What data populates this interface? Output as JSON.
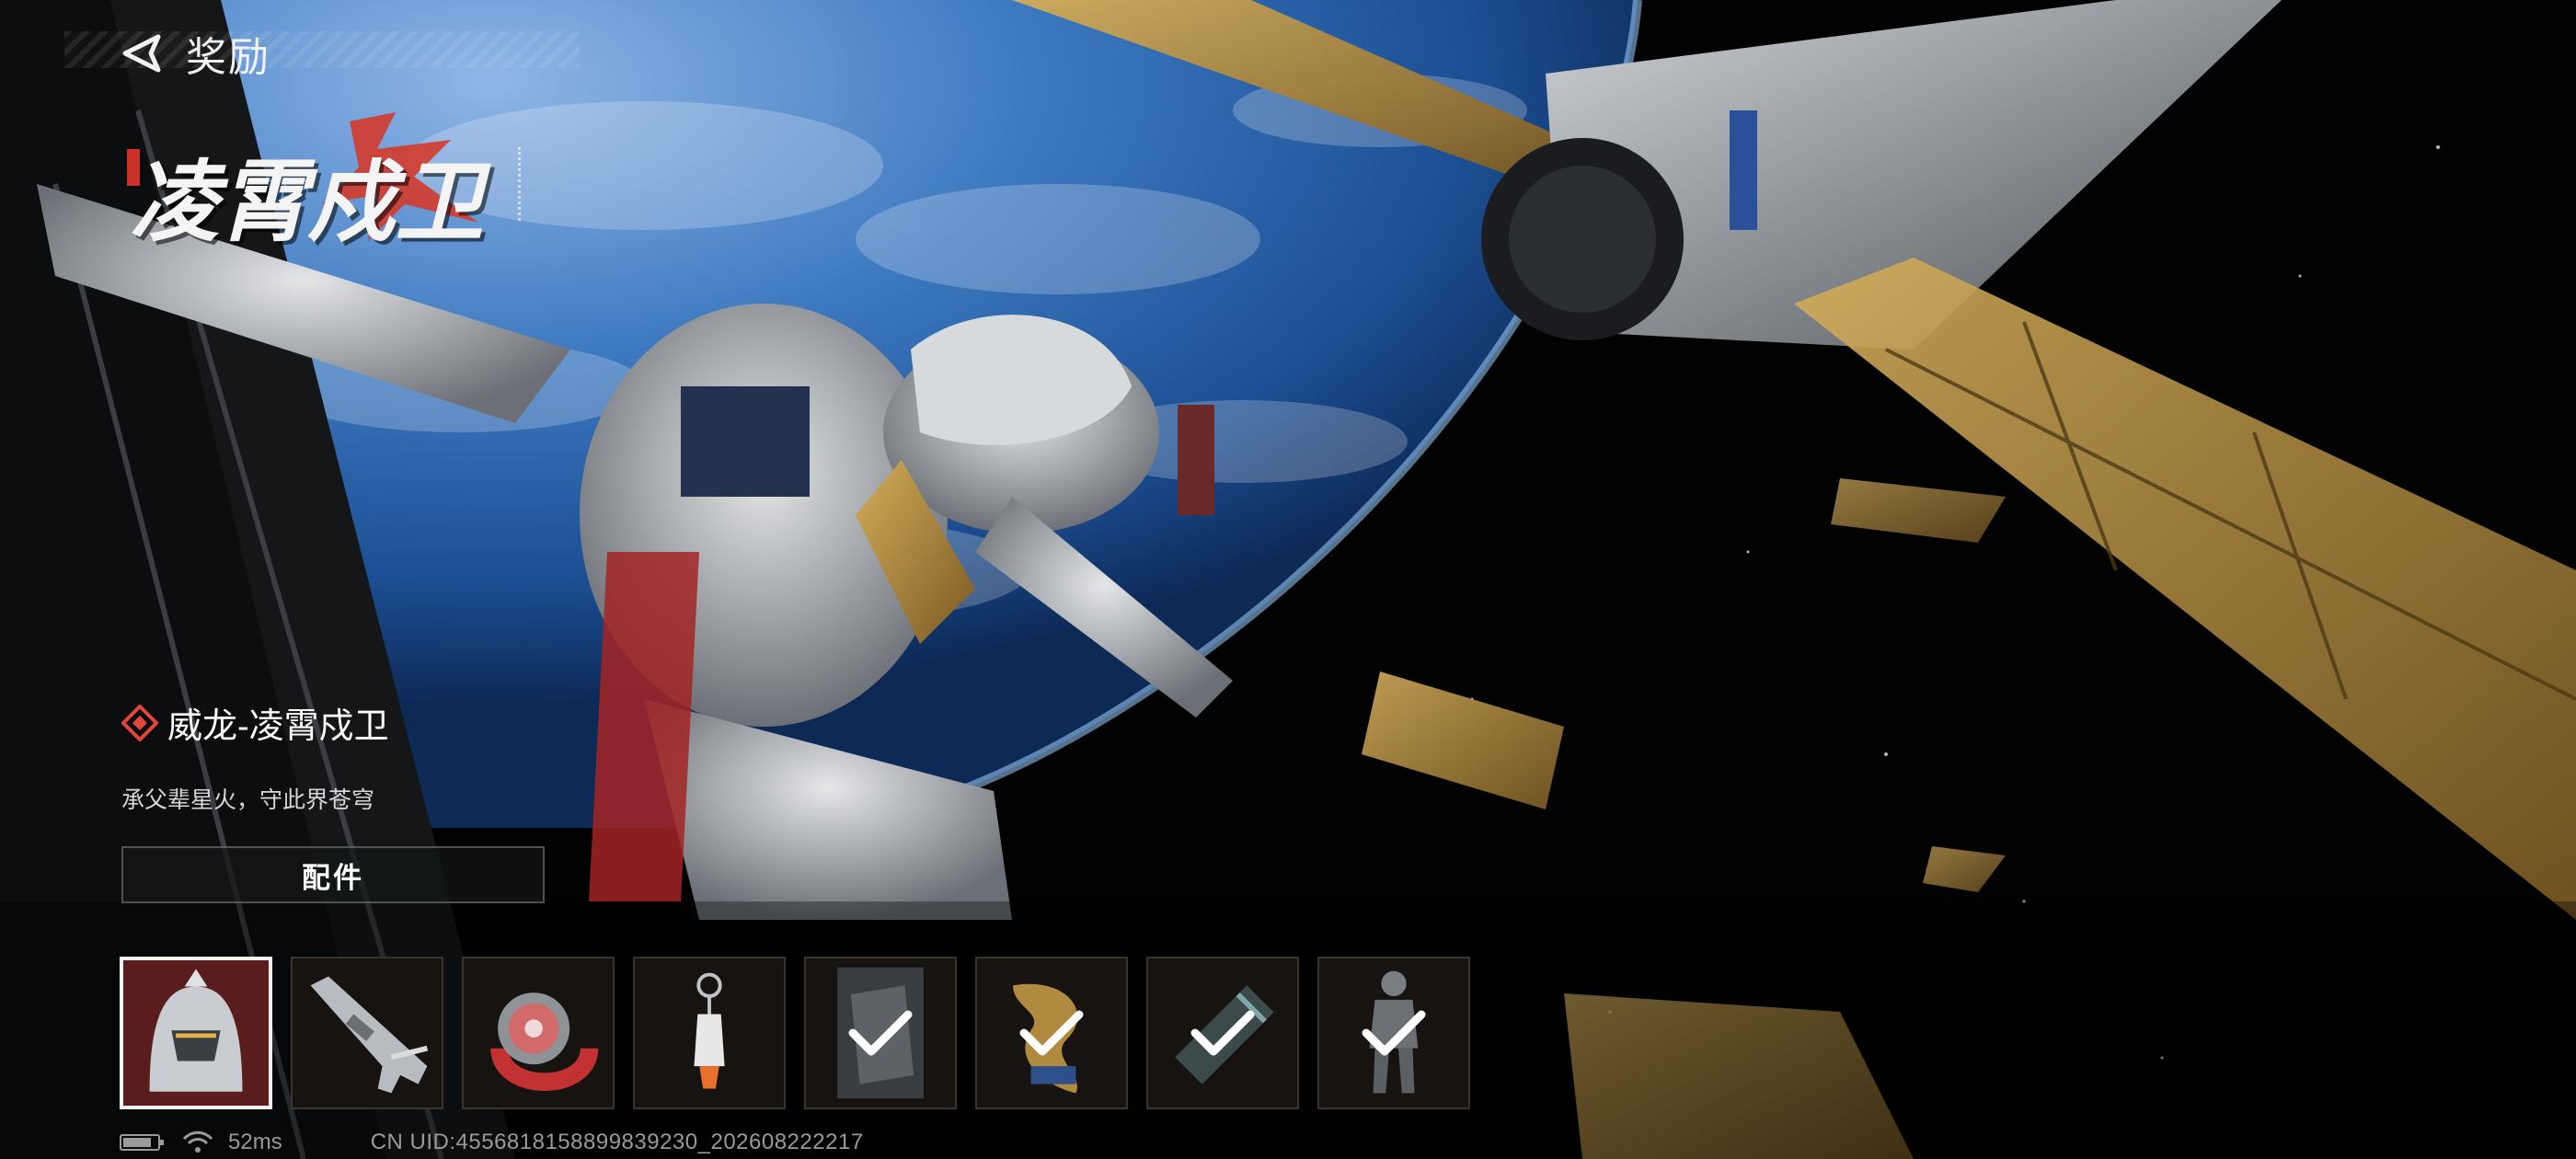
{
  "header": {
    "title": "奖励"
  },
  "logo": {
    "text": "凌霄戍卫"
  },
  "skin": {
    "name": "威龙-凌霄戍卫",
    "description": "承父辈星火，守此界苍穹",
    "rarity_color": "#e0473c"
  },
  "parts_button": {
    "label": "配件"
  },
  "items": [
    {
      "name": "helmet",
      "claimed": false,
      "selected": true
    },
    {
      "name": "rifle",
      "claimed": false,
      "selected": false
    },
    {
      "name": "watch",
      "claimed": false,
      "selected": false
    },
    {
      "name": "keychain",
      "claimed": false,
      "selected": false
    },
    {
      "name": "calling-card",
      "claimed": true,
      "selected": false
    },
    {
      "name": "dragon-emblem",
      "claimed": true,
      "selected": false
    },
    {
      "name": "magazine",
      "claimed": true,
      "selected": false
    },
    {
      "name": "operator-pose",
      "claimed": true,
      "selected": false
    }
  ],
  "status": {
    "battery_level": 0.85,
    "ping": "52ms",
    "uid": "CN UID:4556818158899839230_202608222217"
  },
  "colors": {
    "accent_red": "#e0473c",
    "panel_gold": "#b08a3e",
    "earth_blue": "#2d6fb8"
  }
}
